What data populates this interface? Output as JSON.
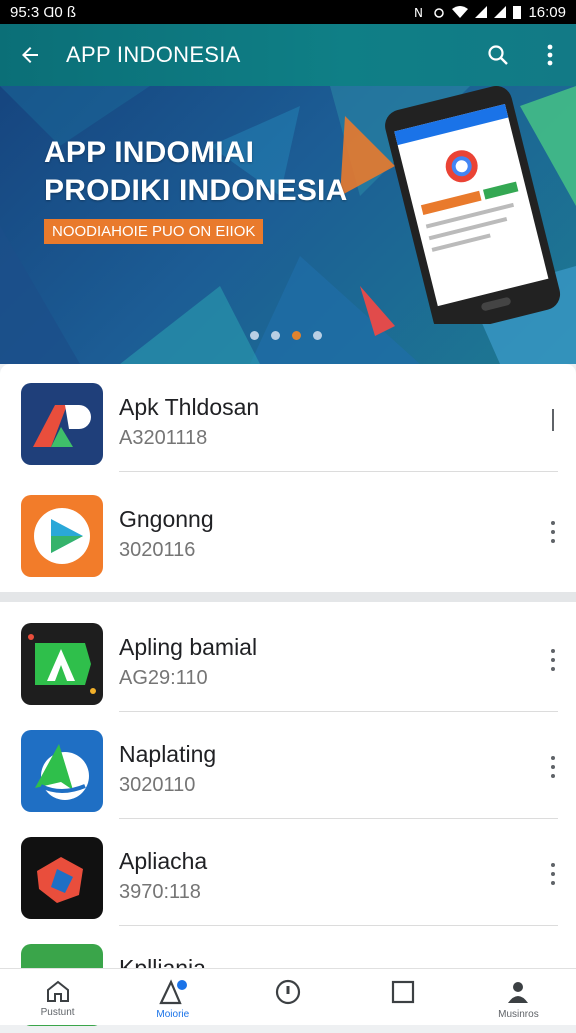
{
  "status_bar": {
    "time_left": "95:3 Ɑ0 ß",
    "time_right": "16:09",
    "icons": [
      "nfc-icon",
      "alarm-icon",
      "wifi-icon",
      "signal-icon",
      "signal-icon",
      "battery-icon"
    ]
  },
  "app_bar": {
    "title": "APP INDONESIA",
    "icons": [
      "back-arrow-icon",
      "search-icon",
      "more-vert-icon"
    ]
  },
  "banner": {
    "line1": "APP INDOMIAI",
    "line2": "PRODIKI INDONESIA",
    "cta": "NOODIAHOIE PUO ON EIIOK",
    "dots": 4,
    "active_dot": 2,
    "colors": {
      "bg_start": "#16457f",
      "bg_end": "#1d7a92",
      "accent": "#e97a2c"
    }
  },
  "apps": [
    {
      "name": "Apk Thldosan",
      "sub": "A3201118",
      "icon": "app-icon-ap"
    },
    {
      "name": "Gngonng",
      "sub": "3020116",
      "icon": "app-icon-play"
    },
    {
      "name": "Apling bamial",
      "sub": "AG29:110",
      "icon": "app-icon-green-a"
    },
    {
      "name": "Naplating",
      "sub": "3020110",
      "icon": "app-icon-blue-a"
    },
    {
      "name": "Apliacha",
      "sub": "3970:118",
      "icon": "app-icon-dark"
    },
    {
      "name": "Kplliania",
      "sub": "",
      "icon": "app-icon-green"
    }
  ],
  "bottom_nav": [
    {
      "label": "Pustunt",
      "icon": "home-icon",
      "active": false
    },
    {
      "label": "Moiorie",
      "icon": "apps-badge-icon",
      "active": true
    },
    {
      "label": "",
      "icon": "info-circle-icon",
      "active": false
    },
    {
      "label": "",
      "icon": "square-icon",
      "active": false
    },
    {
      "label": "Musinros",
      "icon": "person-icon",
      "active": false
    }
  ]
}
